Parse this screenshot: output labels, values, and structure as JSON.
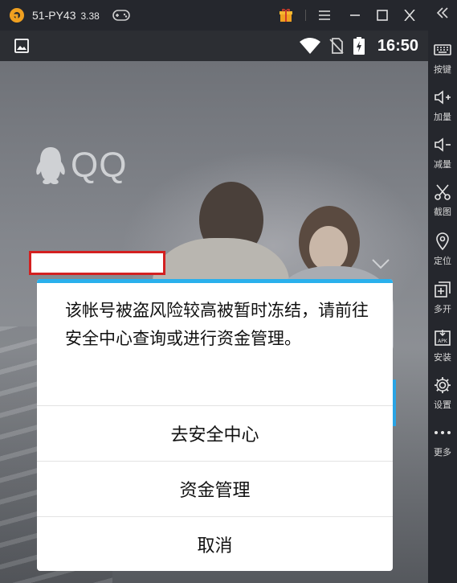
{
  "window": {
    "title": "51-PY43",
    "version": "3.38",
    "icons": [
      "app-logo-icon",
      "gamepad-icon",
      "gift-icon",
      "menu-icon",
      "minimize-icon",
      "maximize-icon",
      "close-icon"
    ]
  },
  "statusbar": {
    "time": "16:50",
    "icons": [
      "image-icon",
      "wifi-icon",
      "no-sim-icon",
      "battery-charging-icon"
    ]
  },
  "sidebar": {
    "items": [
      {
        "label": "按键",
        "icon": "keyboard-icon"
      },
      {
        "label": "加量",
        "icon": "volume-up-icon"
      },
      {
        "label": "减量",
        "icon": "volume-down-icon"
      },
      {
        "label": "截图",
        "icon": "scissors-icon"
      },
      {
        "label": "定位",
        "icon": "location-pin-icon"
      },
      {
        "label": "多开",
        "icon": "multi-instance-icon"
      },
      {
        "label": "安装",
        "icon": "apk-install-icon"
      },
      {
        "label": "设置",
        "icon": "gear-icon"
      },
      {
        "label": "更多",
        "icon": "more-dots-icon"
      }
    ]
  },
  "app": {
    "logo_text": "QQ"
  },
  "dialog": {
    "message": "该帐号被盗风险较高被暂时冻结，请前往安全中心查询或进行资金管理。",
    "buttons": [
      "去安全中心",
      "资金管理",
      "取消"
    ]
  },
  "colors": {
    "accent": "#2ab0ec",
    "highlight_border": "#d32020",
    "chrome": "#25272d"
  }
}
